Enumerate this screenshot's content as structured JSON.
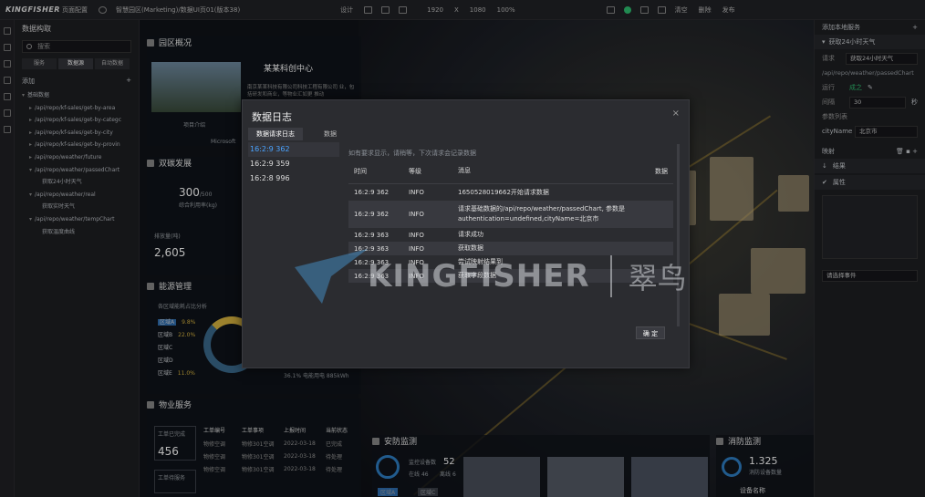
{
  "topbar": {
    "logo": "KINGFISHER",
    "page_config": "页面配置",
    "breadcrumb": "智慧园区(Marketing)/数据UI页01(版本38)",
    "design": "设计",
    "width": "1920",
    "x": "X",
    "height": "1080",
    "zoom": "100%",
    "clear": "清空",
    "delete": "删除",
    "publish": "发布"
  },
  "left": {
    "title": "数据构取",
    "search_placeholder": "搜索",
    "tabs": [
      "服务",
      "数据源",
      "自动数据"
    ],
    "add_label": "添加",
    "add_plus": "+",
    "tree": [
      {
        "label": "基础数据",
        "indent": 1,
        "arrow": "▾"
      },
      {
        "label": "/api/repo/kf-sales/get-by-area",
        "indent": 2,
        "arrow": "▸"
      },
      {
        "label": "/api/repo/kf-sales/get-by-categc",
        "indent": 2,
        "arrow": "▸"
      },
      {
        "label": "/api/repo/kf-sales/get-by-city",
        "indent": 2,
        "arrow": "▸"
      },
      {
        "label": "/api/repo/kf-sales/get-by-provin",
        "indent": 2,
        "arrow": "▸"
      },
      {
        "label": "/api/repo/weather/future",
        "indent": 2,
        "arrow": "▸"
      },
      {
        "label": "/api/repo/weather/passedChart",
        "indent": 2,
        "arrow": "▾"
      },
      {
        "label": "获取24小时天气",
        "indent": 3,
        "arrow": ""
      },
      {
        "label": "/api/repo/weather/real",
        "indent": 2,
        "arrow": "▾"
      },
      {
        "label": "获取实时天气",
        "indent": 3,
        "arrow": ""
      },
      {
        "label": "/api/repo/weather/tempChart",
        "indent": 2,
        "arrow": "▾"
      },
      {
        "label": "获取温度曲线",
        "indent": 3,
        "arrow": ""
      }
    ]
  },
  "canvas": {
    "park_overview": "园区概况",
    "company": "某某科创中心",
    "company_desc": "南京某某科技有限公司科技工程有限公司 业，包括研发和商业，等物业汇如更 推动",
    "intro": "项目介绍",
    "microsoft": "Microsoft",
    "dual_carbon": "双碳发展",
    "carbon_val": "300",
    "carbon_total": "/500",
    "carbon_label": "综合利用率(kg)",
    "gas_label": "排放量(吨)",
    "gas_val": "2,605",
    "energy": "能源管理",
    "energy_sub": "各区域能耗占比分析",
    "areas": [
      "区域A",
      "区域B",
      "区域C",
      "区域D",
      "区域E"
    ],
    "percents": [
      "9.8%",
      "22.0%",
      "",
      "",
      "11.0%"
    ],
    "elec_pct": "36.1%",
    "elec_label": "电能用电 885kWh",
    "property": "物业服务",
    "work_done": "工单已完成",
    "work_done_val": "456",
    "work_pending": "工单待服务",
    "col_order": "工单编号",
    "col_item": "工单事项",
    "col_time": "上报时间",
    "col_status": "当前状态",
    "rows": [
      {
        "item": "物修空调",
        "loc": "物修301空调",
        "date": "2022-03-18",
        "status": "已完成"
      },
      {
        "item": "物修空调",
        "loc": "物修301空调",
        "date": "2022-03-18",
        "status": "待处理"
      },
      {
        "item": "物修空调",
        "loc": "物修301空调",
        "date": "2022-03-18",
        "status": "待处理"
      }
    ],
    "security": "安防监测",
    "cam_total_label": "监控设备数",
    "cam_total": "52",
    "online": "在线",
    "online_val": "46",
    "offline": "离线",
    "offline_val": "6",
    "zone_a": "区域A",
    "zone_c": "区域C",
    "fire": "消防监测",
    "fire_val": "1.325",
    "fire_label": "消防设备数量",
    "device_name": "设备名称"
  },
  "right": {
    "title": "添加本地服务",
    "section": "获取24小时天气",
    "req_label": "请求",
    "req_value": "获取24小时天气",
    "url": "/api/repo/weather/passedChart",
    "run_label": "运行",
    "run_value": "成之",
    "interval_label": "间隔",
    "interval_value": "30",
    "interval_unit": "秒",
    "params_label": "参数列表",
    "param_name": "cityName",
    "param_value": "北京市",
    "map_label": "映射",
    "result_label": "结果",
    "attr_label": "属性",
    "event_label": "请选择事件"
  },
  "modal": {
    "title": "数据日志",
    "close": "×",
    "tabs": [
      "数据请求日志",
      "数据"
    ],
    "times": [
      "16:2:9 362",
      "16:2:9 359",
      "16:2:8 996"
    ],
    "note": "如有要求显示，请稍等，下次请求会记录数据",
    "headers": [
      "时间",
      "等级",
      "消息",
      "数据"
    ],
    "rows": [
      {
        "time": "16:2:9 362",
        "level": "INFO",
        "msg": "1650528019662开始请求数据"
      },
      {
        "time": "16:2:9 362",
        "level": "INFO",
        "msg": "请求基础数据的/api/repo/weather/passedChart, 参数是authentication=undefined,cityName=北京市"
      },
      {
        "time": "16:2:9 363",
        "level": "INFO",
        "msg": "请求成功"
      },
      {
        "time": "16:2:9 363",
        "level": "INFO",
        "msg": "获取数据"
      },
      {
        "time": "16:2:9 363",
        "level": "INFO",
        "msg": "尝试映射结果到"
      },
      {
        "time": "16:2:9 363",
        "level": "INFO",
        "msg": "获取字段数据"
      }
    ],
    "ok": "确 定"
  },
  "watermark": {
    "brand": "KINGFISHER",
    "cn": "翠鸟"
  }
}
